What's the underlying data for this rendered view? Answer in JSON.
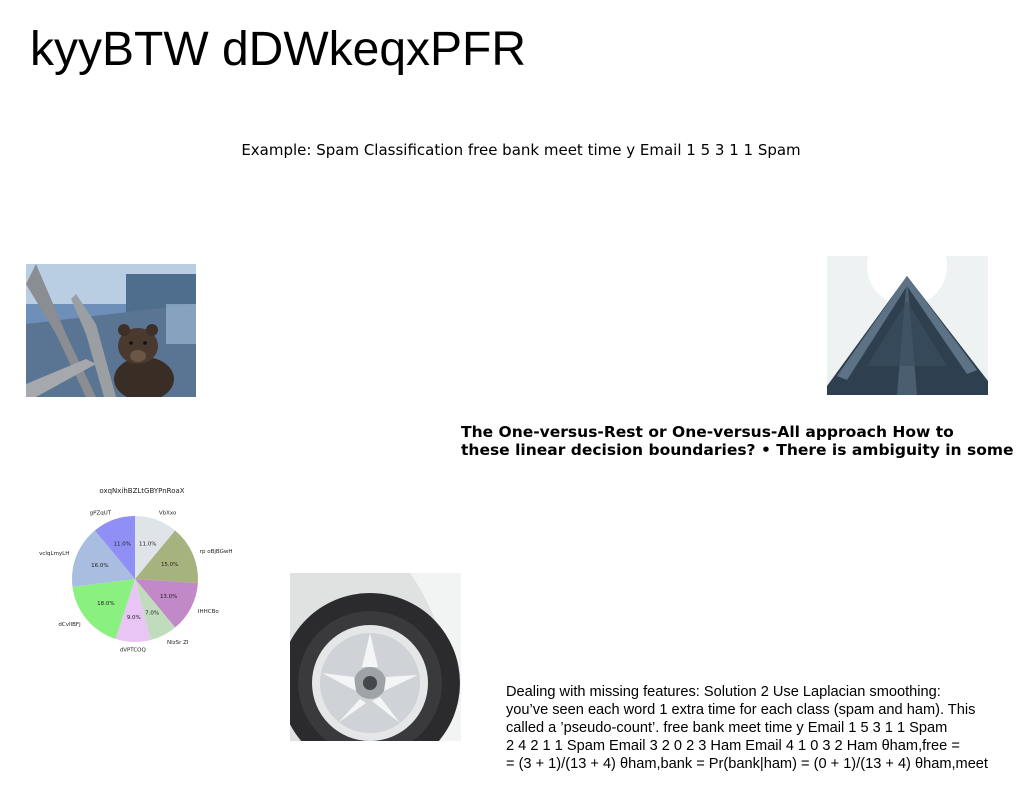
{
  "title": "kyyBTW dDWkeqxPFR",
  "subtitle": "Example: Spam Classification free bank meet time y Email 1 5 3 1 1 Spam",
  "bold_text": [
    "The One-versus-Rest or One-versus-All approach How to",
    "these linear decision boundaries? • There is ambiguity in some"
  ],
  "body_text": [
    "Dealing with missing features: Solution 2 Use Laplacian smoothing:",
    "you’ve seen each word 1 extra time for each class (spam and ham). This",
    "called a ’pseudo-count’. free bank meet time y Email 1 5 3 1 1 Spam",
    "2 4 2 1 1 Spam Email 3 2 0 2 3 Ham Email 4 1 0 3 2 Ham θham,free =",
    "= (3 + 1)/(13 + 4) θham,bank = Pr(bank|ham) = (0 + 1)/(13 + 4) θham,meet"
  ],
  "chart_data": {
    "type": "pie",
    "title": "oxqNxihBZLtGBYPnRoaX",
    "slices": [
      {
        "label": "VbXxo",
        "value": 11.0,
        "pct_label": "11.0%",
        "color": "#dfe4e8"
      },
      {
        "label": "rp oBjBGwH",
        "value": 15.0,
        "pct_label": "15.0%",
        "color": "#a7b37f"
      },
      {
        "label": "IHHCBo",
        "value": 13.0,
        "pct_label": "13.0%",
        "color": "#c189c7"
      },
      {
        "label": "NIzSr ZI",
        "value": 7.0,
        "pct_label": "7.0%",
        "color": "#c1dbbd"
      },
      {
        "label": "dVPTCOQ",
        "value": 9.0,
        "pct_label": "9.0%",
        "color": "#e8c5f5"
      },
      {
        "label": "dCvIlBFj",
        "value": 18.0,
        "pct_label": "18.0%",
        "color": "#8af07f"
      },
      {
        "label": "vcIqLmyLH",
        "value": 16.0,
        "pct_label": "16.0%",
        "color": "#a8bde0"
      },
      {
        "label": "gPZqUT",
        "value": 11.0,
        "pct_label": "11.0%",
        "color": "#8f8ff5"
      }
    ],
    "start_angle": "top",
    "direction": "clockwise"
  }
}
